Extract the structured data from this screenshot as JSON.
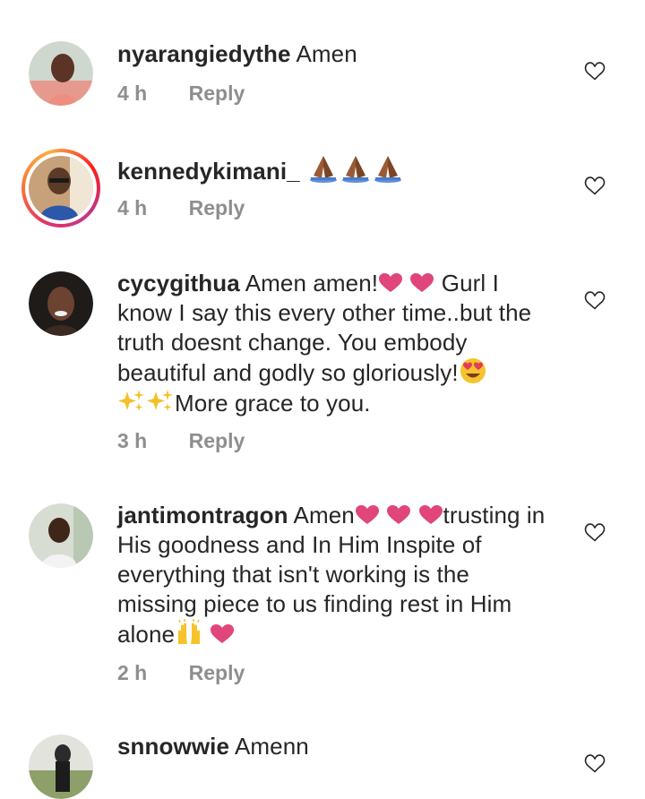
{
  "comments": [
    {
      "username": "nyarangiedythe",
      "text": "Amen",
      "time": "4 h",
      "reply_label": "Reply"
    },
    {
      "username": "kennedykimani_",
      "text": "",
      "emoji": [
        "folded-hands",
        "folded-hands",
        "folded-hands"
      ],
      "time": "4 h",
      "reply_label": "Reply"
    },
    {
      "username": "cycygithua",
      "text_part1": "Amen amen!",
      "text_part2": " Gurl I know I say this every other time..but the truth doesnt change. You embody beautiful and godly so gloriously!",
      "text_part3": "More grace to you.",
      "emoji": [
        "red-heart",
        "red-heart",
        "heart-eyes",
        "sparkles",
        "sparkles"
      ],
      "time": "3 h",
      "reply_label": "Reply"
    },
    {
      "username": "jantimontragon",
      "text_part1": "Amen",
      "text_part2": "trusting in His goodness  and In Him Inspite of everything that isn't  working is the missing  piece  to us finding  rest in Him alone",
      "emoji": [
        "red-heart",
        "red-heart",
        "red-heart",
        "raising-hands",
        "red-heart"
      ],
      "time": "2 h",
      "reply_label": "Reply"
    },
    {
      "username": "snnowwie",
      "text": "Amenn"
    }
  ],
  "icons": {
    "like": "heart-outline-icon"
  },
  "colors": {
    "text": "#262626",
    "meta": "#8e8e8e",
    "emoji_heart": "#e0457b"
  }
}
